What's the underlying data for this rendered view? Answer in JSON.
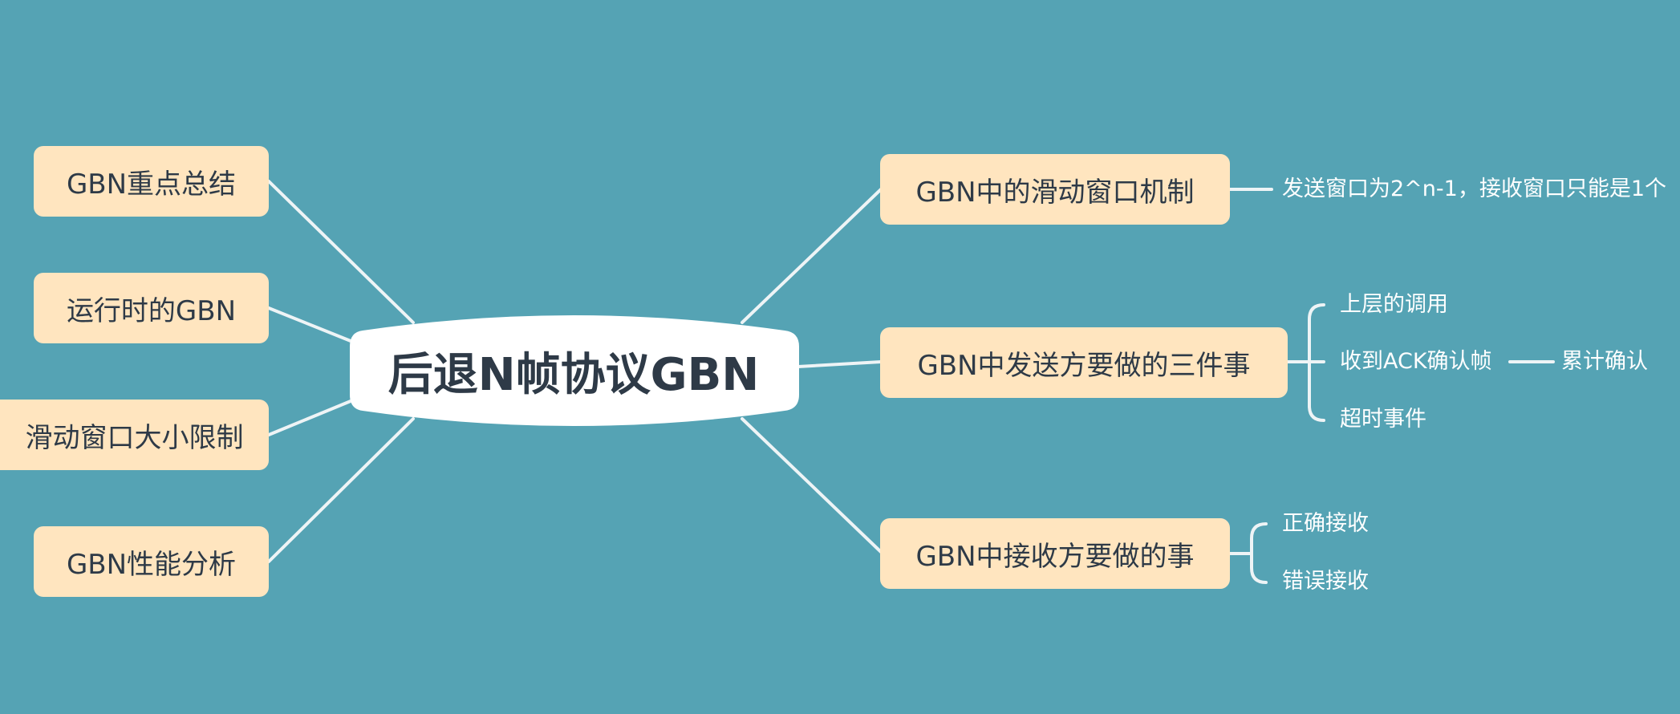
{
  "diagram": {
    "central": "后退N帧协议GBN",
    "left_topics": [
      "GBN重点总结",
      "运行时的GBN",
      "滑动窗口大小限制",
      "GBN性能分析"
    ],
    "right_topics": {
      "window": {
        "label": "GBN中的滑动窗口机制",
        "children": [
          "发送窗口为2^n-1，接收窗口只能是1个"
        ]
      },
      "sender": {
        "label": "GBN中发送方要做的三件事",
        "children": [
          "上层的调用",
          "收到ACK确认帧",
          "超时事件"
        ],
        "ack_child": "累计确认"
      },
      "receiver": {
        "label": "GBN中接收方要做的事",
        "children": [
          "正确接收",
          "错误接收"
        ]
      }
    }
  },
  "colors": {
    "background": "#55a3b4",
    "topic_fill": "#ffe5bf",
    "central_fill": "#ffffff",
    "line": "#eef4f6",
    "text_dark": "#2e3a47",
    "text_light": "#ffffff"
  }
}
